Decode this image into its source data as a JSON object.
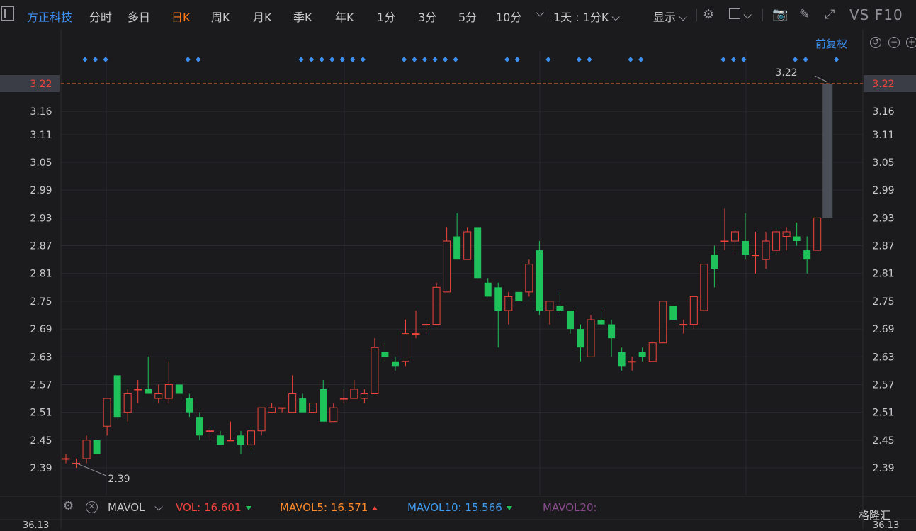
{
  "toolbar": {
    "stock_name": "方正科技",
    "periods": [
      "分时",
      "多日",
      "日K",
      "周K",
      "月K",
      "季K",
      "年K",
      "1分",
      "3分",
      "5分",
      "10分"
    ],
    "active_period": "日K",
    "interval_select": "1天 : 1分K",
    "display_label": "显示",
    "vs_label": "VS F10"
  },
  "chart": {
    "adjust_label": "前复权",
    "current_price_label": "3.22",
    "high_annotation": "3.22",
    "low_annotation": "2.39",
    "y_ticks": [
      "3.22",
      "3.16",
      "3.11",
      "3.05",
      "2.99",
      "2.93",
      "2.87",
      "2.81",
      "2.75",
      "2.69",
      "2.63",
      "2.57",
      "2.51",
      "2.45",
      "2.39"
    ]
  },
  "chart_data": {
    "type": "candlestick",
    "ylim": [
      2.35,
      3.24
    ],
    "ticks": [
      3.22,
      3.16,
      3.11,
      3.05,
      2.99,
      2.93,
      2.87,
      2.81,
      2.75,
      2.69,
      2.63,
      2.57,
      2.51,
      2.45,
      2.39
    ],
    "candles": [
      {
        "o": 2.41,
        "h": 2.42,
        "l": 2.4,
        "c": 2.41
      },
      {
        "o": 2.4,
        "h": 2.41,
        "l": 2.39,
        "c": 2.4
      },
      {
        "o": 2.41,
        "h": 2.46,
        "l": 2.4,
        "c": 2.45
      },
      {
        "o": 2.45,
        "h": 2.45,
        "l": 2.42,
        "c": 2.42
      },
      {
        "o": 2.48,
        "h": 2.54,
        "l": 2.46,
        "c": 2.54
      },
      {
        "o": 2.59,
        "h": 2.59,
        "l": 2.5,
        "c": 2.5
      },
      {
        "o": 2.51,
        "h": 2.56,
        "l": 2.49,
        "c": 2.55
      },
      {
        "o": 2.56,
        "h": 2.58,
        "l": 2.53,
        "c": 2.56
      },
      {
        "o": 2.56,
        "h": 2.63,
        "l": 2.55,
        "c": 2.55
      },
      {
        "o": 2.54,
        "h": 2.57,
        "l": 2.53,
        "c": 2.55
      },
      {
        "o": 2.54,
        "h": 2.62,
        "l": 2.53,
        "c": 2.57
      },
      {
        "o": 2.57,
        "h": 2.57,
        "l": 2.55,
        "c": 2.55
      },
      {
        "o": 2.54,
        "h": 2.55,
        "l": 2.5,
        "c": 2.51
      },
      {
        "o": 2.5,
        "h": 2.51,
        "l": 2.45,
        "c": 2.46
      },
      {
        "o": 2.47,
        "h": 2.48,
        "l": 2.45,
        "c": 2.47
      },
      {
        "o": 2.46,
        "h": 2.47,
        "l": 2.44,
        "c": 2.44
      },
      {
        "o": 2.45,
        "h": 2.49,
        "l": 2.45,
        "c": 2.45
      },
      {
        "o": 2.46,
        "h": 2.47,
        "l": 2.42,
        "c": 2.44
      },
      {
        "o": 2.44,
        "h": 2.48,
        "l": 2.43,
        "c": 2.47
      },
      {
        "o": 2.47,
        "h": 2.52,
        "l": 2.46,
        "c": 2.52
      },
      {
        "o": 2.51,
        "h": 2.53,
        "l": 2.51,
        "c": 2.52
      },
      {
        "o": 2.52,
        "h": 2.52,
        "l": 2.51,
        "c": 2.52
      },
      {
        "o": 2.51,
        "h": 2.59,
        "l": 2.51,
        "c": 2.55
      },
      {
        "o": 2.54,
        "h": 2.55,
        "l": 2.51,
        "c": 2.51
      },
      {
        "o": 2.51,
        "h": 2.53,
        "l": 2.51,
        "c": 2.53
      },
      {
        "o": 2.56,
        "h": 2.58,
        "l": 2.49,
        "c": 2.49
      },
      {
        "o": 2.49,
        "h": 2.53,
        "l": 2.49,
        "c": 2.52
      },
      {
        "o": 2.54,
        "h": 2.56,
        "l": 2.53,
        "c": 2.54
      },
      {
        "o": 2.54,
        "h": 2.58,
        "l": 2.55,
        "c": 2.56
      },
      {
        "o": 2.54,
        "h": 2.56,
        "l": 2.53,
        "c": 2.55
      },
      {
        "o": 2.55,
        "h": 2.67,
        "l": 2.55,
        "c": 2.65
      },
      {
        "o": 2.64,
        "h": 2.66,
        "l": 2.62,
        "c": 2.63
      },
      {
        "o": 2.62,
        "h": 2.63,
        "l": 2.6,
        "c": 2.61
      },
      {
        "o": 2.62,
        "h": 2.71,
        "l": 2.61,
        "c": 2.68
      },
      {
        "o": 2.68,
        "h": 2.73,
        "l": 2.67,
        "c": 2.68
      },
      {
        "o": 2.7,
        "h": 2.71,
        "l": 2.68,
        "c": 2.7
      },
      {
        "o": 2.7,
        "h": 2.79,
        "l": 2.7,
        "c": 2.78
      },
      {
        "o": 2.77,
        "h": 2.91,
        "l": 2.77,
        "c": 2.88
      },
      {
        "o": 2.89,
        "h": 2.94,
        "l": 2.84,
        "c": 2.84
      },
      {
        "o": 2.84,
        "h": 2.91,
        "l": 2.84,
        "c": 2.9
      },
      {
        "o": 2.91,
        "h": 2.91,
        "l": 2.8,
        "c": 2.8
      },
      {
        "o": 2.79,
        "h": 2.8,
        "l": 2.76,
        "c": 2.76
      },
      {
        "o": 2.78,
        "h": 2.79,
        "l": 2.65,
        "c": 2.73
      },
      {
        "o": 2.73,
        "h": 2.77,
        "l": 2.7,
        "c": 2.76
      },
      {
        "o": 2.77,
        "h": 2.77,
        "l": 2.75,
        "c": 2.75
      },
      {
        "o": 2.77,
        "h": 2.84,
        "l": 2.76,
        "c": 2.83
      },
      {
        "o": 2.86,
        "h": 2.88,
        "l": 2.72,
        "c": 2.73
      },
      {
        "o": 2.73,
        "h": 2.75,
        "l": 2.7,
        "c": 2.75
      },
      {
        "o": 2.74,
        "h": 2.77,
        "l": 2.72,
        "c": 2.73
      },
      {
        "o": 2.73,
        "h": 2.73,
        "l": 2.68,
        "c": 2.69
      },
      {
        "o": 2.69,
        "h": 2.7,
        "l": 2.62,
        "c": 2.65
      },
      {
        "o": 2.63,
        "h": 2.72,
        "l": 2.63,
        "c": 2.71
      },
      {
        "o": 2.71,
        "h": 2.73,
        "l": 2.7,
        "c": 2.7
      },
      {
        "o": 2.7,
        "h": 2.71,
        "l": 2.63,
        "c": 2.67
      },
      {
        "o": 2.64,
        "h": 2.65,
        "l": 2.6,
        "c": 2.61
      },
      {
        "o": 2.62,
        "h": 2.63,
        "l": 2.6,
        "c": 2.62
      },
      {
        "o": 2.64,
        "h": 2.65,
        "l": 2.62,
        "c": 2.63
      },
      {
        "o": 2.62,
        "h": 2.66,
        "l": 2.62,
        "c": 2.66
      },
      {
        "o": 2.66,
        "h": 2.75,
        "l": 2.66,
        "c": 2.75
      },
      {
        "o": 2.74,
        "h": 2.74,
        "l": 2.71,
        "c": 2.71
      },
      {
        "o": 2.7,
        "h": 2.71,
        "l": 2.68,
        "c": 2.7
      },
      {
        "o": 2.7,
        "h": 2.76,
        "l": 2.69,
        "c": 2.76
      },
      {
        "o": 2.73,
        "h": 2.83,
        "l": 2.73,
        "c": 2.83
      },
      {
        "o": 2.85,
        "h": 2.87,
        "l": 2.78,
        "c": 2.82
      },
      {
        "o": 2.88,
        "h": 2.95,
        "l": 2.86,
        "c": 2.88
      },
      {
        "o": 2.88,
        "h": 2.91,
        "l": 2.86,
        "c": 2.9
      },
      {
        "o": 2.88,
        "h": 2.94,
        "l": 2.84,
        "c": 2.85
      },
      {
        "o": 2.85,
        "h": 2.9,
        "l": 2.81,
        "c": 2.85
      },
      {
        "o": 2.84,
        "h": 2.9,
        "l": 2.82,
        "c": 2.88
      },
      {
        "o": 2.86,
        "h": 2.91,
        "l": 2.85,
        "c": 2.9
      },
      {
        "o": 2.89,
        "h": 2.91,
        "l": 2.86,
        "c": 2.9
      },
      {
        "o": 2.89,
        "h": 2.92,
        "l": 2.87,
        "c": 2.88
      },
      {
        "o": 2.86,
        "h": 2.89,
        "l": 2.81,
        "c": 2.84
      },
      {
        "o": 2.86,
        "h": 2.93,
        "l": 2.86,
        "c": 2.93
      },
      {
        "o": 2.93,
        "h": 3.22,
        "l": 2.93,
        "c": 3.22
      }
    ],
    "event_markers": [
      0,
      1,
      2,
      10,
      11,
      21,
      22,
      23,
      24,
      25,
      26,
      27,
      31,
      32,
      33,
      34,
      35,
      36,
      41,
      42,
      45,
      48,
      49,
      53,
      54,
      62,
      63,
      64,
      69,
      70,
      73
    ]
  },
  "volume": {
    "mavol_label": "MAVOL",
    "vol_label": "VOL:",
    "vol_value": "16.601",
    "mavol5_label": "MAVOL5:",
    "mavol5_value": "16.571",
    "mavol10_label": "MAVOL10:",
    "mavol10_value": "15.566",
    "mavol20_label": "MAVOL20:",
    "bottom_left_value": "36.13",
    "bottom_right_value": "36.13"
  },
  "colors": {
    "up": "#f0443c",
    "down": "#1fc25a",
    "accent": "#3d8ff0",
    "active": "#ff7a1f",
    "price_line": "#ff6a3d"
  },
  "watermark": "格隆汇"
}
